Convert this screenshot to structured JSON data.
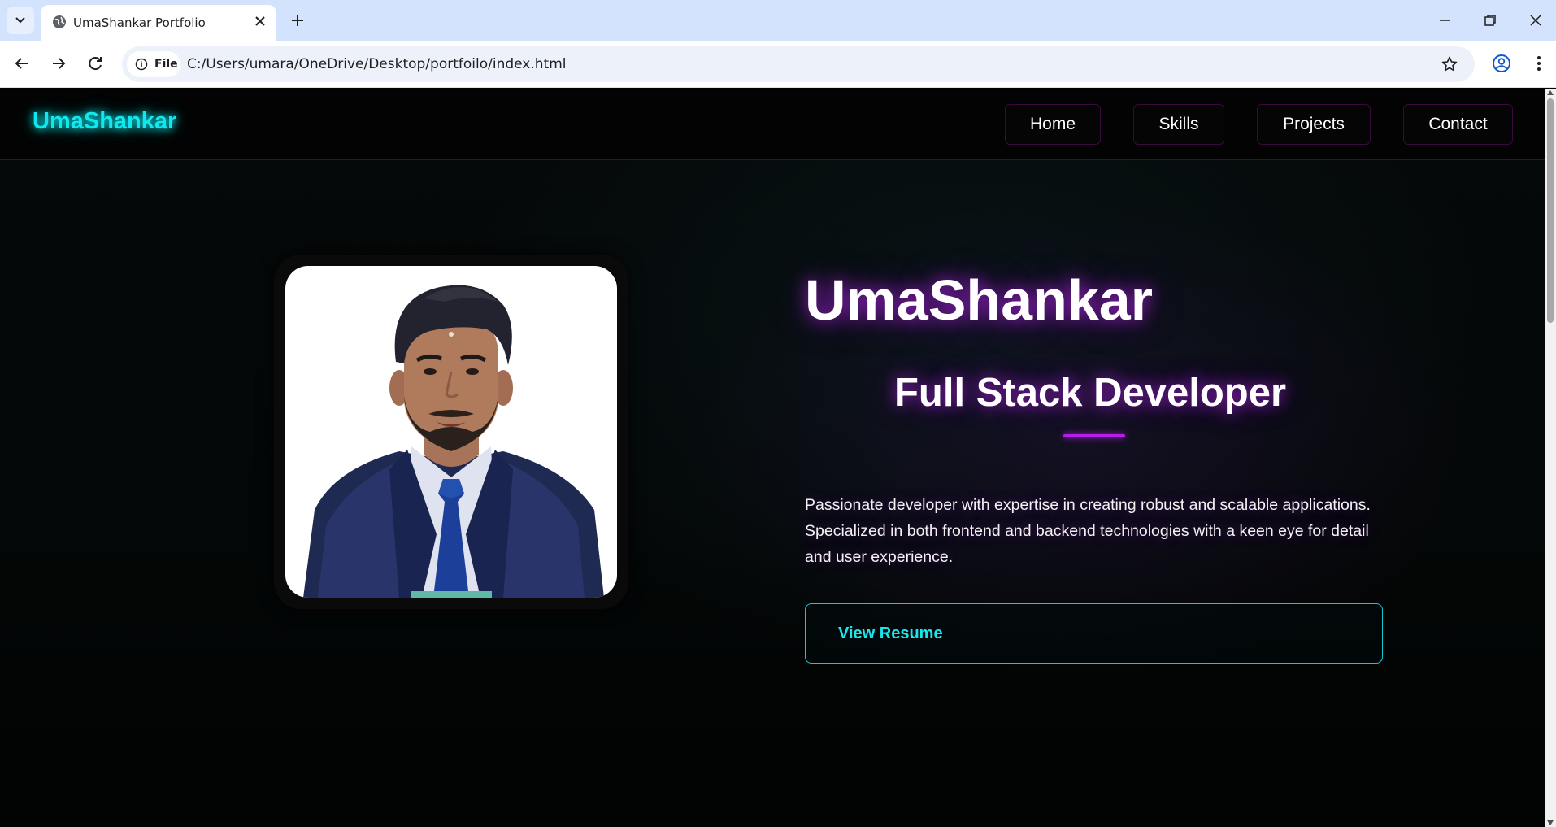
{
  "browser": {
    "tab_title": "UmaShankar Portfolio",
    "chip_label": "File",
    "url": "C:/Users/umara/OneDrive/Desktop/portfoilo/index.html"
  },
  "navbar": {
    "logo": "UmaShankar",
    "links": [
      "Home",
      "Skills",
      "Projects",
      "Contact"
    ]
  },
  "hero": {
    "name": "UmaShankar",
    "role": "Full Stack Developer",
    "description": "Passionate developer with expertise in creating robust and scalable applications. Specialized in both frontend and backend technologies with a keen eye for detail and user experience.",
    "button": "View Resume"
  },
  "colors": {
    "accent_cyan": "#12e6ee",
    "accent_purple": "#b41ee6",
    "background": "#000000"
  }
}
